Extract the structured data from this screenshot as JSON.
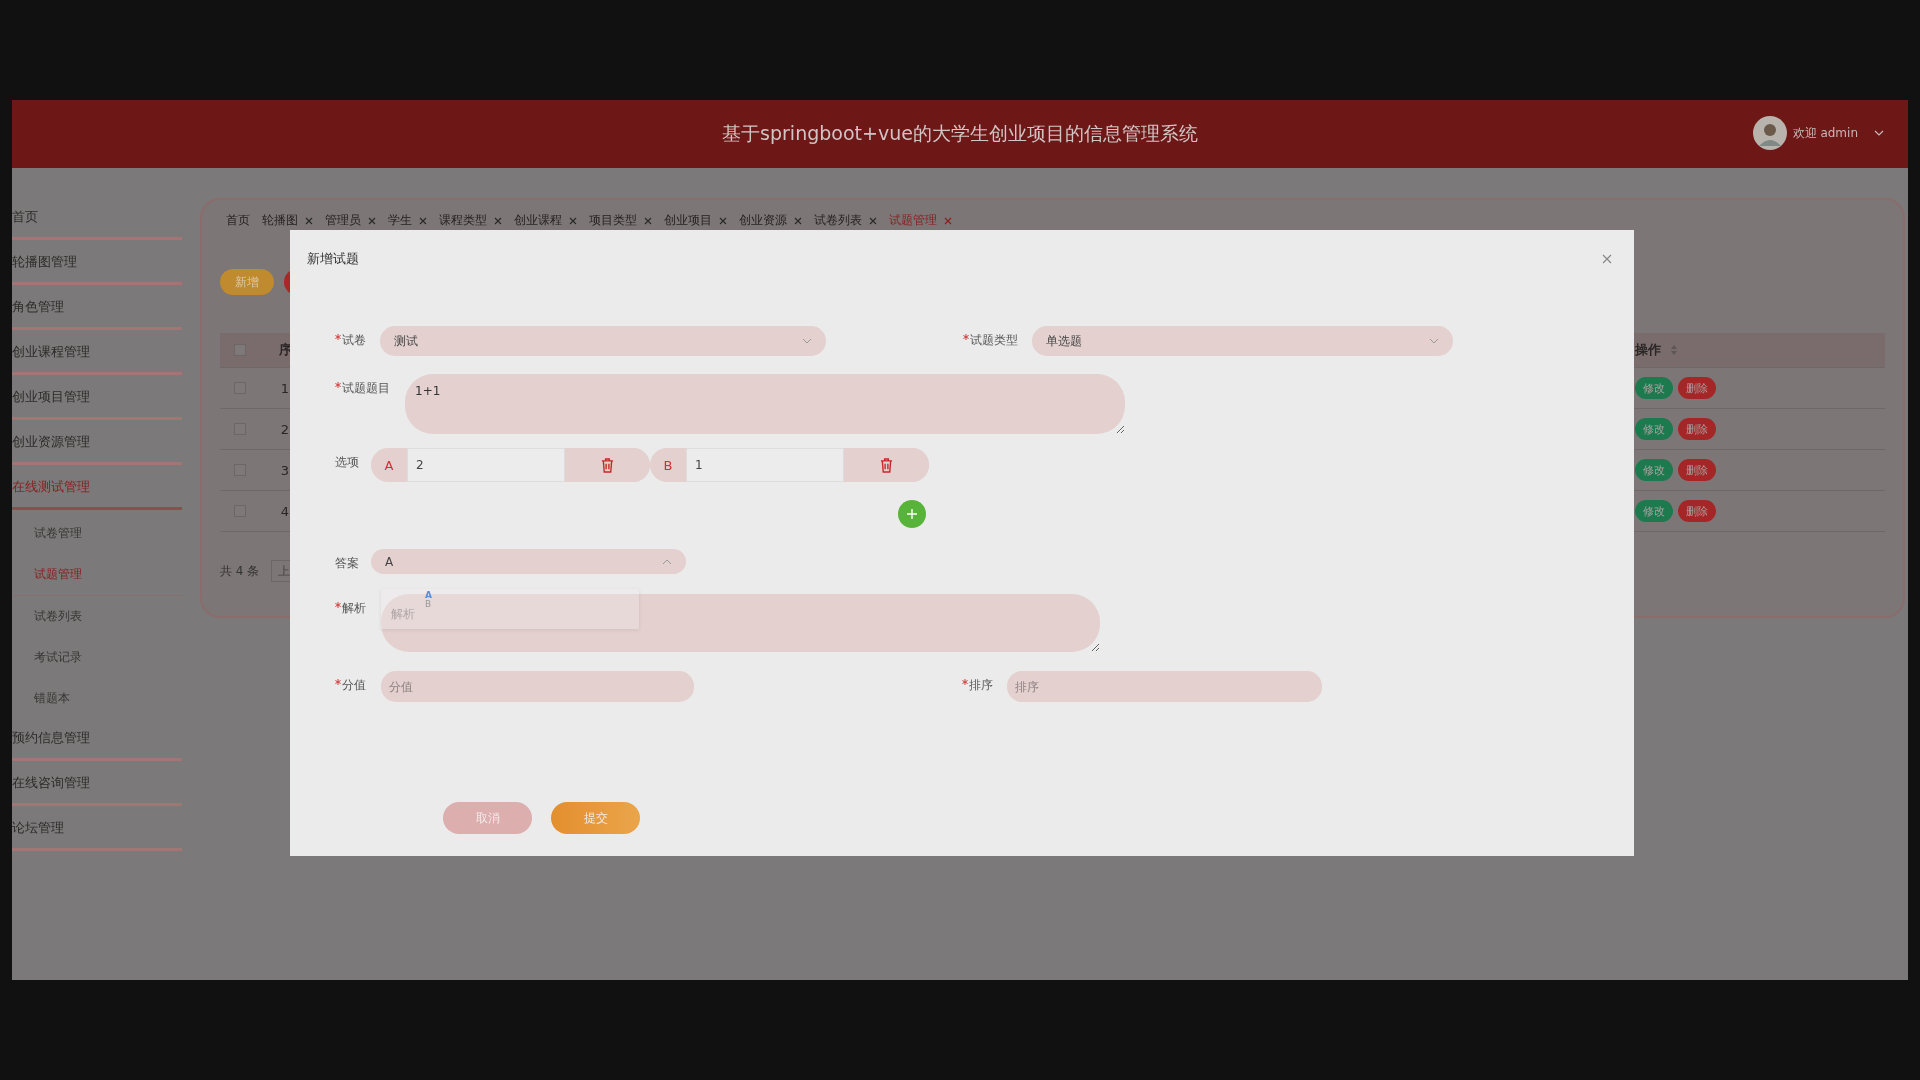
{
  "header": {
    "title": "基于springboot+vue的大学生创业项目的信息管理系统",
    "user": "欢迎 admin"
  },
  "sidebar": {
    "items": [
      {
        "label": "首页",
        "expanded": false
      },
      {
        "label": "轮播图管理",
        "expanded": false
      },
      {
        "label": "角色管理",
        "expanded": false
      },
      {
        "label": "创业课程管理",
        "expanded": false
      },
      {
        "label": "创业项目管理",
        "expanded": false
      },
      {
        "label": "创业资源管理",
        "expanded": false
      },
      {
        "label": "在线测试管理",
        "expanded": true,
        "children": [
          {
            "label": "试卷管理",
            "selected": false
          },
          {
            "label": "试题管理",
            "selected": true
          },
          {
            "label": "试卷列表",
            "selected": false
          },
          {
            "label": "考试记录",
            "selected": false
          },
          {
            "label": "错题本",
            "selected": false
          }
        ]
      },
      {
        "label": "预约信息管理",
        "expanded": false
      },
      {
        "label": "在线咨询管理",
        "expanded": false
      },
      {
        "label": "论坛管理",
        "expanded": false
      }
    ]
  },
  "tabs": [
    {
      "label": "首页",
      "closable": false,
      "selected": false
    },
    {
      "label": "轮播图",
      "closable": true,
      "selected": false
    },
    {
      "label": "管理员",
      "closable": true,
      "selected": false
    },
    {
      "label": "学生",
      "closable": true,
      "selected": false
    },
    {
      "label": "课程类型",
      "closable": true,
      "selected": false
    },
    {
      "label": "创业课程",
      "closable": true,
      "selected": false
    },
    {
      "label": "项目类型",
      "closable": true,
      "selected": false
    },
    {
      "label": "创业项目",
      "closable": true,
      "selected": false
    },
    {
      "label": "创业资源",
      "closable": true,
      "selected": false
    },
    {
      "label": "试卷列表",
      "closable": true,
      "selected": false
    },
    {
      "label": "试题管理",
      "closable": true,
      "selected": true
    }
  ],
  "toolbar": {
    "add_button": "新增"
  },
  "table": {
    "columns": [
      "序",
      "操作"
    ],
    "all_checked": false,
    "rows": [
      {
        "checked": false,
        "index": "1",
        "edit": "修改",
        "delete": "删除"
      },
      {
        "checked": false,
        "index": "2",
        "edit": "修改",
        "delete": "删除"
      },
      {
        "checked": false,
        "index": "3",
        "edit": "修改",
        "delete": "删除"
      },
      {
        "checked": false,
        "index": "4",
        "edit": "修改",
        "delete": "删除"
      }
    ],
    "total": "共 4 条",
    "pager_prev": "上"
  },
  "dialog": {
    "title": "新增试题",
    "paper": {
      "label": "试卷",
      "required": true,
      "value": "测试"
    },
    "type": {
      "label": "试题类型",
      "required": true,
      "value": "单选题"
    },
    "question": {
      "label": "试题题目",
      "required": true,
      "value": "1+1"
    },
    "options": {
      "label": "选项",
      "items": [
        {
          "letter": "A",
          "value": "2"
        },
        {
          "letter": "B",
          "value": "1"
        }
      ]
    },
    "answer": {
      "label": "答案",
      "value": "A",
      "expanded": true,
      "choices": [
        {
          "label": "A",
          "selected": true
        },
        {
          "label": "B",
          "selected": false
        }
      ]
    },
    "analysis": {
      "label": "解析",
      "required": true,
      "placeholder": "解析"
    },
    "score": {
      "label": "分值",
      "required": true,
      "placeholder": "分值"
    },
    "order": {
      "label": "排序",
      "required": true,
      "placeholder": "排序"
    },
    "buttons": [
      {
        "label": "取消",
        "kind": "cancel"
      },
      {
        "label": "提交",
        "kind": "submit"
      }
    ]
  }
}
